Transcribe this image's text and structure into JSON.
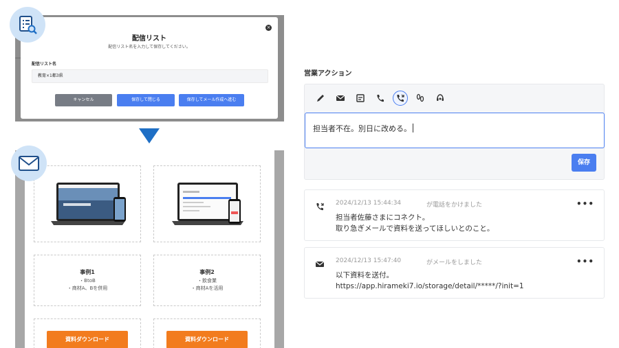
{
  "dialog": {
    "title": "配信リスト",
    "subtitle": "配信リスト名を入力して保存してください。",
    "field_label": "配信リスト名",
    "field_value": "教育×1都3県",
    "buttons": {
      "cancel": "キャンセル",
      "save_close": "保存して閉じる",
      "save_mail": "保存してメール作成へ進む"
    }
  },
  "email": {
    "cases": [
      {
        "title": "事例1",
        "lines": [
          "・BtoB",
          "・商材A、Bを併用"
        ],
        "button": "資料ダウンロード"
      },
      {
        "title": "事例2",
        "lines": [
          "・飲食業",
          "・商材Aを活用"
        ],
        "button": "資料ダウンロード"
      }
    ]
  },
  "sales_action": {
    "title": "営業アクション",
    "tools": [
      "pencil-icon",
      "mail-icon",
      "note-icon",
      "phone-icon",
      "phone-active-icon",
      "footprints-icon",
      "support-icon"
    ],
    "memo_text": "担当者不在。別日に改める。",
    "save_label": "保存",
    "logs": [
      {
        "icon": "phone-icon",
        "date": "2024/12/13 15:44:34",
        "type": "が電話をかけました",
        "more": "•••",
        "text": [
          "担当者佐藤さまにコネクト。",
          "取り急ぎメールで資料を送ってほしいとのこと。"
        ]
      },
      {
        "icon": "mail-icon",
        "date": "2024/12/13 15:47:40",
        "type": "がメールをしました",
        "more": "•••",
        "text": [
          "以下資料を送付。",
          "https://app.hirameki7.io/storage/detail/*****/?init=1"
        ]
      }
    ]
  },
  "colors": {
    "accent": "#4a7ef0",
    "orange": "#f27c1e",
    "arrow": "#1f6fc5",
    "badge": "#cfe3f7"
  }
}
